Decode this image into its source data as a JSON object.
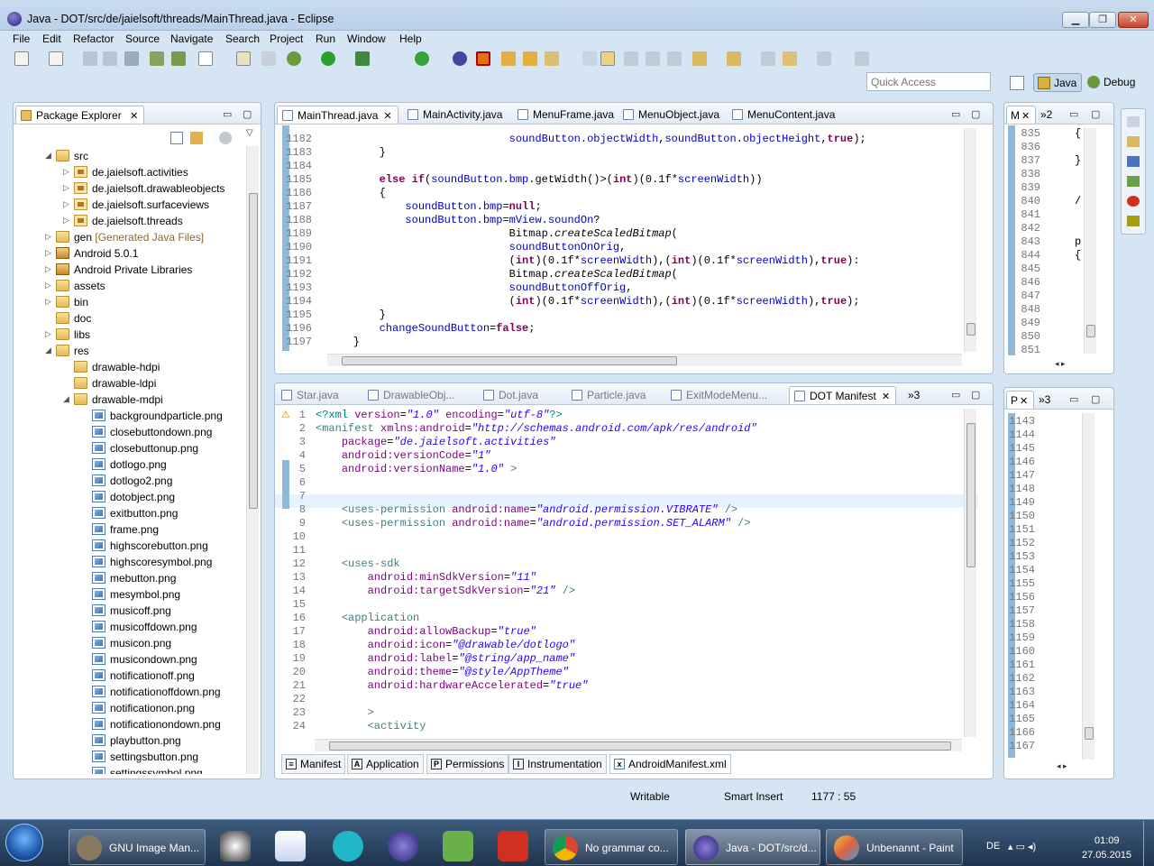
{
  "window": {
    "title": "Java - DOT/src/de/jaielsoft/threads/MainThread.java - Eclipse",
    "min": "▁",
    "max": "❐",
    "close": "✕"
  },
  "menu": [
    "File",
    "Edit",
    "Refactor",
    "Source",
    "Navigate",
    "Search",
    "Project",
    "Run",
    "Window",
    "Help"
  ],
  "quick_access": {
    "placeholder": "Quick Access"
  },
  "perspectives": [
    {
      "label": "Java",
      "active": true
    },
    {
      "label": "Debug",
      "active": false
    }
  ],
  "package_explorer": {
    "title": "Package Explorer",
    "items": [
      {
        "label": "src",
        "type": "folder",
        "depth": 1,
        "open": true
      },
      {
        "label": "de.jaielsoft.activities",
        "type": "pkg",
        "depth": 2
      },
      {
        "label": "de.jaielsoft.drawableobjects",
        "type": "pkg",
        "depth": 2
      },
      {
        "label": "de.jaielsoft.surfaceviews",
        "type": "pkg",
        "depth": 2
      },
      {
        "label": "de.jaielsoft.threads",
        "type": "pkg",
        "depth": 2
      },
      {
        "label": "gen",
        "suffix": "[Generated Java Files]",
        "type": "folder",
        "depth": 1
      },
      {
        "label": "Android 5.0.1",
        "type": "lib",
        "depth": 1
      },
      {
        "label": "Android Private Libraries",
        "type": "lib",
        "depth": 1
      },
      {
        "label": "assets",
        "type": "folder",
        "depth": 1
      },
      {
        "label": "bin",
        "type": "folder",
        "depth": 1
      },
      {
        "label": "doc",
        "type": "folder",
        "depth": 1,
        "leaf": true
      },
      {
        "label": "libs",
        "type": "folder",
        "depth": 1
      },
      {
        "label": "res",
        "type": "folder",
        "depth": 1,
        "open": true
      },
      {
        "label": "drawable-hdpi",
        "type": "folder",
        "depth": 2,
        "leaf": true
      },
      {
        "label": "drawable-ldpi",
        "type": "folder",
        "depth": 2,
        "leaf": true
      },
      {
        "label": "drawable-mdpi",
        "type": "folder",
        "depth": 2,
        "open": true
      },
      {
        "label": "backgroundparticle.png",
        "type": "png",
        "depth": 3
      },
      {
        "label": "closebuttondown.png",
        "type": "png",
        "depth": 3
      },
      {
        "label": "closebuttonup.png",
        "type": "png",
        "depth": 3
      },
      {
        "label": "dotlogo.png",
        "type": "png",
        "depth": 3
      },
      {
        "label": "dotlogo2.png",
        "type": "png",
        "depth": 3
      },
      {
        "label": "dotobject.png",
        "type": "png",
        "depth": 3
      },
      {
        "label": "exitbutton.png",
        "type": "png",
        "depth": 3
      },
      {
        "label": "frame.png",
        "type": "png",
        "depth": 3
      },
      {
        "label": "highscorebutton.png",
        "type": "png",
        "depth": 3
      },
      {
        "label": "highscoresymbol.png",
        "type": "png",
        "depth": 3
      },
      {
        "label": "mebutton.png",
        "type": "png",
        "depth": 3
      },
      {
        "label": "mesymbol.png",
        "type": "png",
        "depth": 3
      },
      {
        "label": "musicoff.png",
        "type": "png",
        "depth": 3
      },
      {
        "label": "musicoffdown.png",
        "type": "png",
        "depth": 3
      },
      {
        "label": "musicon.png",
        "type": "png",
        "depth": 3
      },
      {
        "label": "musicondown.png",
        "type": "png",
        "depth": 3
      },
      {
        "label": "notificationoff.png",
        "type": "png",
        "depth": 3
      },
      {
        "label": "notificationoffdown.png",
        "type": "png",
        "depth": 3
      },
      {
        "label": "notificationon.png",
        "type": "png",
        "depth": 3
      },
      {
        "label": "notificationondown.png",
        "type": "png",
        "depth": 3
      },
      {
        "label": "playbutton.png",
        "type": "png",
        "depth": 3
      },
      {
        "label": "settingsbutton.png",
        "type": "png",
        "depth": 3
      },
      {
        "label": "settingssymbol.png",
        "type": "png",
        "depth": 3
      }
    ]
  },
  "editor_top": {
    "tabs": [
      "MainThread.java",
      "MainActivity.java",
      "MenuFrame.java",
      "MenuObject.java",
      "MenuContent.java"
    ],
    "line_numbers": [
      "1182",
      "1183",
      "1184",
      "1185",
      "1186",
      "1187",
      "1188",
      "1189",
      "1190",
      "1191",
      "1192",
      "1193",
      "1194",
      "1195",
      "1196",
      "1197"
    ]
  },
  "editor_bottom": {
    "tabs": [
      "Star.java",
      "DrawableObj...",
      "Dot.java",
      "Particle.java",
      "ExitModeMenu...",
      "DOT Manifest"
    ],
    "overflow": "»3",
    "line_numbers": [
      "1",
      "2",
      "3",
      "4",
      "5",
      "6",
      "7",
      "8",
      "9",
      "10",
      "11",
      "12",
      "13",
      "14",
      "15",
      "16",
      "17",
      "18",
      "19",
      "20",
      "21",
      "22",
      "23",
      "24"
    ],
    "bottom_tabs": [
      "Manifest",
      "Application",
      "Permissions",
      "Instrumentation",
      "AndroidManifest.xml"
    ]
  },
  "right_top": {
    "tabs": [
      "M",
      "»2"
    ],
    "line_numbers": [
      "835",
      "836",
      "837",
      "838",
      "839",
      "840",
      "841",
      "842",
      "843",
      "844",
      "845",
      "846",
      "847",
      "848",
      "849",
      "850",
      "851"
    ],
    "code": [
      "{",
      "",
      "}",
      "",
      "",
      "/",
      "",
      "",
      "p",
      "{",
      "",
      "",
      "",
      "",
      "",
      "",
      ""
    ]
  },
  "right_bottom": {
    "tabs": [
      "P",
      "»3"
    ],
    "line_numbers": [
      "1143",
      "1144",
      "1145",
      "1146",
      "1147",
      "1148",
      "1149",
      "1150",
      "1151",
      "1152",
      "1153",
      "1154",
      "1155",
      "1156",
      "1157",
      "1158",
      "1159",
      "1160",
      "1161",
      "1162",
      "1163",
      "1164",
      "1165",
      "1166",
      "1167"
    ]
  },
  "status": {
    "mode": "Writable",
    "insert": "Smart Insert",
    "position": "1177 : 55"
  },
  "taskbar": {
    "tasks": [
      "GNU Image Man...",
      "No grammar co...",
      "Java - DOT/src/d...",
      "Unbenannt - Paint"
    ],
    "lang": "DE",
    "time": "01:09",
    "date": "27.05.2015"
  },
  "colors": {
    "accent": "#2c5d9e",
    "keyword": "#7f0055",
    "field": "#0000c0",
    "string": "#2a00ff"
  }
}
